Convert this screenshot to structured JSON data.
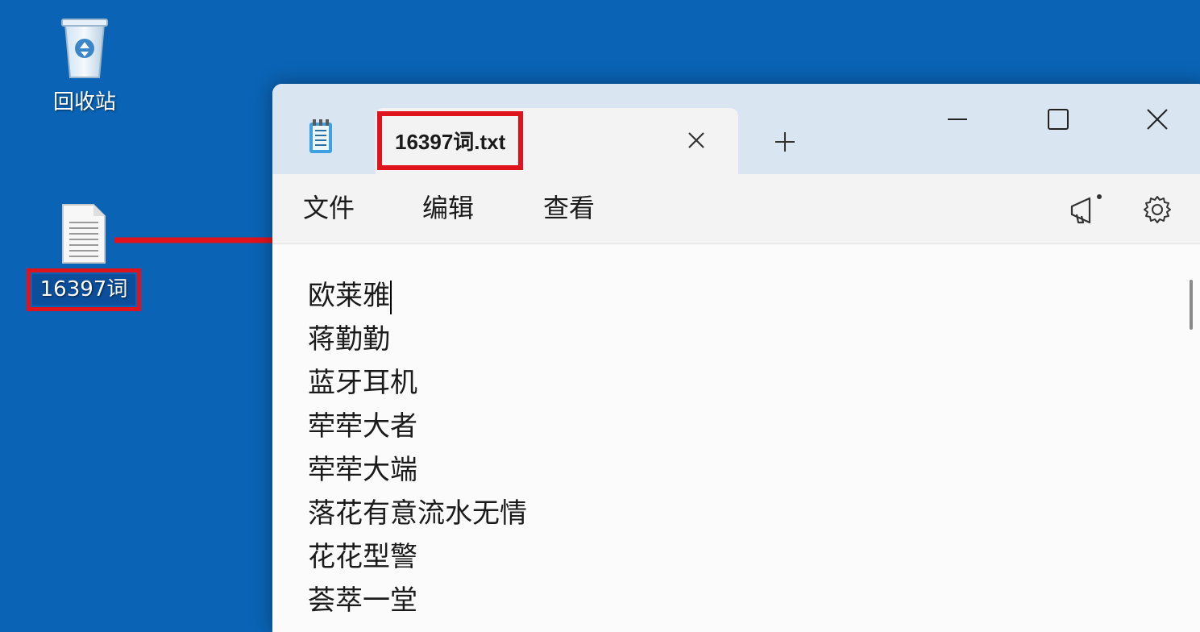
{
  "desktop": {
    "icons": [
      {
        "label": "回收站",
        "icon": "recycle-bin-icon"
      },
      {
        "label": "16397词",
        "icon": "text-file-icon"
      }
    ]
  },
  "window": {
    "app_icon": "notepad-icon",
    "tab": {
      "title": "16397词.txt"
    },
    "new_tab_icon": "plus-icon",
    "controls": [
      "minimize-icon",
      "maximize-icon",
      "close-icon"
    ]
  },
  "menu": {
    "items": [
      "文件",
      "编辑",
      "查看"
    ],
    "right_icons": [
      "megaphone-icon",
      "gear-icon"
    ]
  },
  "editor": {
    "lines": [
      "欧莱雅",
      "蒋勤勤",
      "蓝牙耳机",
      "荦荦大者",
      "荦荦大端",
      "落花有意流水无情",
      "花花型警",
      "荟萃一堂"
    ]
  },
  "colors": {
    "desktop_background": "#0a63b4",
    "annotation_red": "#e0131c",
    "titlebar": "#d9e5f1"
  }
}
